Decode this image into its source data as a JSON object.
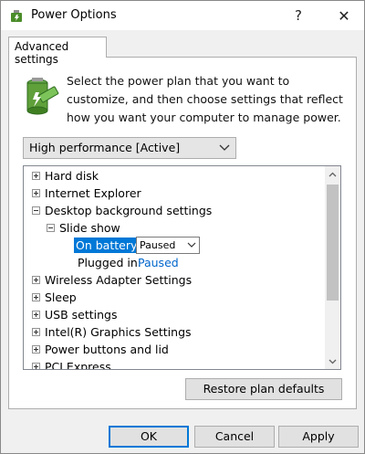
{
  "window": {
    "title": "Power Options",
    "help_label": "?",
    "close_label": "✕"
  },
  "tabs": [
    {
      "label": "Advanced settings",
      "active": true
    }
  ],
  "intro_text": "Select the power plan that you want to customize, and then choose settings that reflect how you want your computer to manage power.",
  "plan_dropdown": {
    "selected": "High performance [Active]"
  },
  "tree": {
    "items": [
      {
        "label": "Hard disk",
        "expanded": false
      },
      {
        "label": "Internet Explorer",
        "expanded": false
      },
      {
        "label": "Desktop background settings",
        "expanded": true
      },
      {
        "label": "Slide show",
        "expanded": true
      },
      {
        "label": "On battery:",
        "value": "Paused",
        "selected": true
      },
      {
        "label": "Plugged in:",
        "value": "Paused"
      },
      {
        "label": "Wireless Adapter Settings",
        "expanded": false
      },
      {
        "label": "Sleep",
        "expanded": false
      },
      {
        "label": "USB settings",
        "expanded": false
      },
      {
        "label": "Intel(R) Graphics Settings",
        "expanded": false
      },
      {
        "label": "Power buttons and lid",
        "expanded": false
      },
      {
        "label": "PCI Express",
        "expanded": false
      }
    ]
  },
  "buttons": {
    "restore": "Restore plan defaults",
    "ok": "OK",
    "cancel": "Cancel",
    "apply": "Apply"
  },
  "colors": {
    "accent": "#0078d7",
    "link": "#0066cc",
    "window_bg": "#f0f0f0"
  }
}
